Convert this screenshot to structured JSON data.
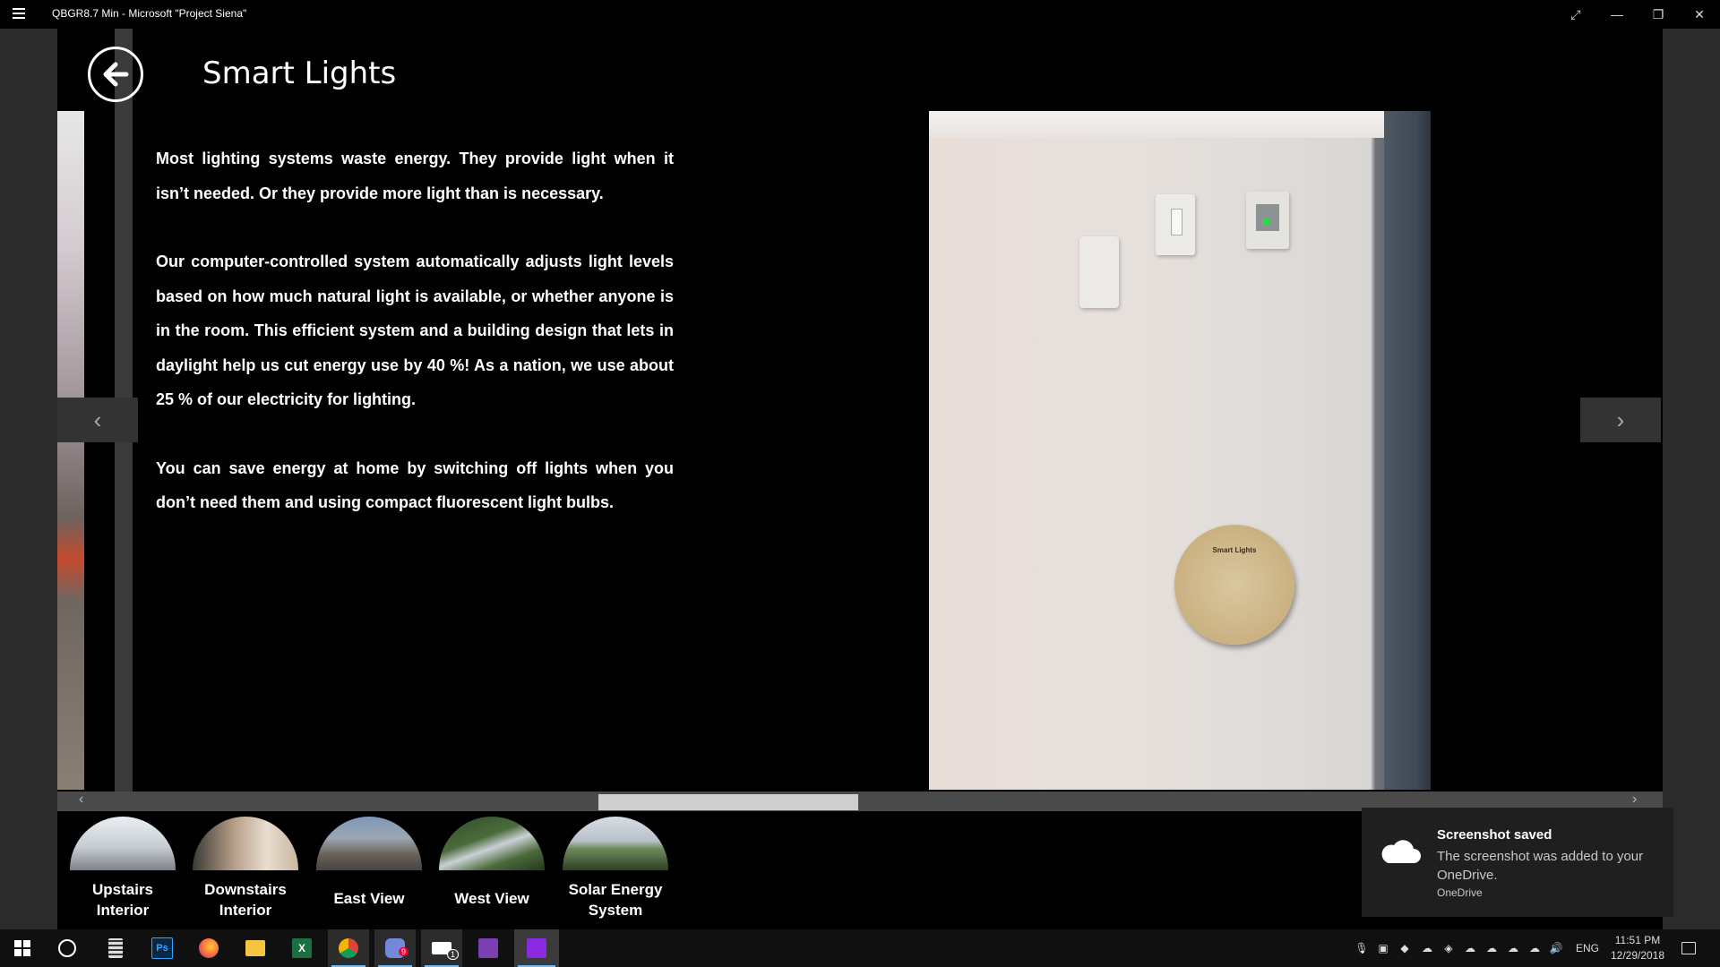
{
  "window": {
    "title": "QBGR8.7 Min - Microsoft \"Project Siena\"",
    "menu_icon": "hamburger-icon",
    "controls": [
      "expand-icon",
      "minimize-icon",
      "restore-icon",
      "close-icon"
    ]
  },
  "page": {
    "title": "Smart Lights",
    "paragraphs": [
      "Most lighting systems waste energy. They provide light when it isn’t needed. Or they provide more light than is necessary.",
      "Our computer-controlled system automatically adjusts light levels based on how much natural light is available, or whether anyone is in the room. This efficient system and a building design that lets in daylight help us cut energy use by 40 %! As a nation, we use about 25 % of our electricity for lighting.",
      "You can save energy at home by switching off lights when you don’t need them and using compact fluorescent light bulbs."
    ],
    "plaque_text": "Smart Lights"
  },
  "nav": {
    "prev": "‹",
    "next": "›"
  },
  "gallery": [
    {
      "label": "Upstairs\nInterior",
      "l1": "Upstairs",
      "l2": "Interior",
      "tone": "#c9ced3"
    },
    {
      "label": "Downstairs\nInterior",
      "l1": "Downstairs",
      "l2": "Interior",
      "tone": "#b8a08a"
    },
    {
      "label": "East View",
      "l1": "East View",
      "l2": "",
      "tone": "#7f97b8"
    },
    {
      "label": "West View",
      "l1": "West View",
      "l2": "",
      "tone": "#4b6b3b"
    },
    {
      "label": "Solar Energy\nSystem",
      "l1": "Solar Energy",
      "l2": "System",
      "tone": "#6d8a5a"
    }
  ],
  "toast": {
    "title": "Screenshot saved",
    "message": "The screenshot was added to your OneDrive.",
    "app": "OneDrive",
    "icon": "cloud-icon"
  },
  "taskbar": {
    "apps": [
      "start-icon",
      "cortana-icon",
      "calculator-icon",
      "photoshop-icon",
      "firefox-icon",
      "file-explorer-icon",
      "excel-icon",
      "chrome-icon",
      "discord-icon",
      "mail-icon",
      "app-purple-icon",
      "project-siena-icon"
    ],
    "ps_label": "Ps",
    "excel_label": "X",
    "mail_badge": "1",
    "discord_badge": "9",
    "language": "ENG",
    "time": "11:51 PM",
    "date": "12/29/2018"
  },
  "colors": {
    "background": "#000000",
    "frame": "#2b2b2b",
    "taskbar": "#101010",
    "accent": "#76b9ed",
    "siena_purple": "#8a2be2"
  }
}
